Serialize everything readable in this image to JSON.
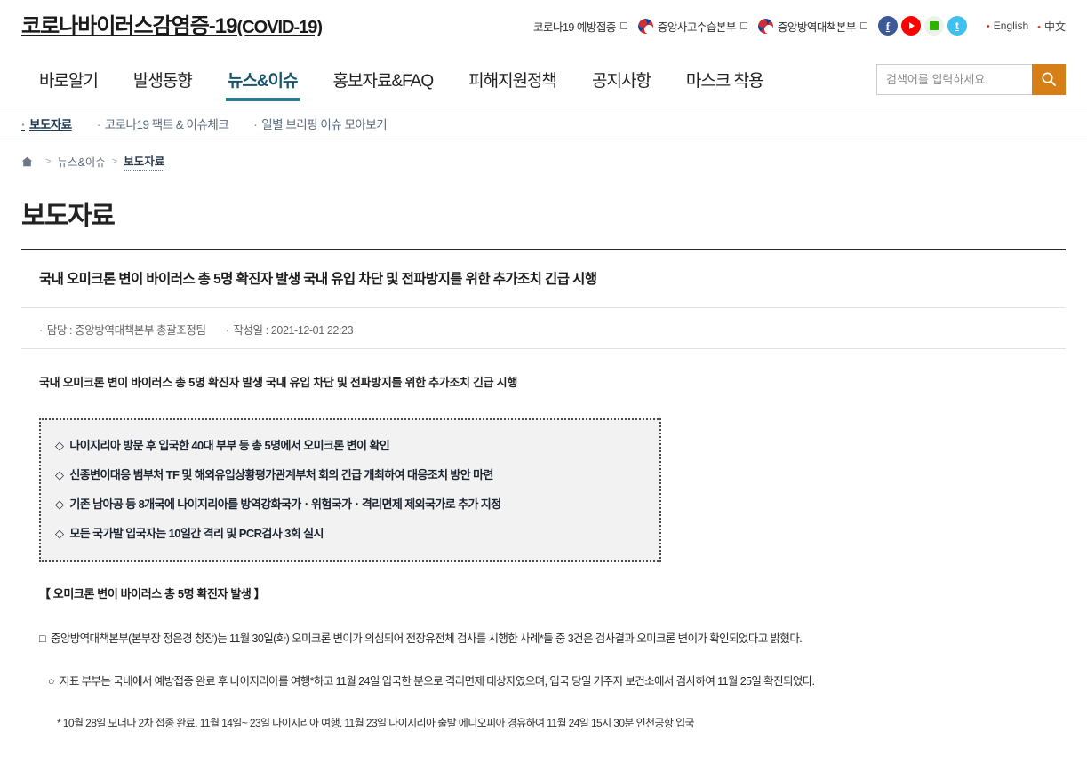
{
  "header": {
    "logo_ko": "코로나바이러스감염증-19",
    "logo_en": "(COVID-19)",
    "links": [
      {
        "label": "코로나19 예방접종",
        "icon": "external-link-icon",
        "has_gov_mark": false
      },
      {
        "label": "중앙사고수습본부",
        "icon": "external-link-icon",
        "has_gov_mark": true
      },
      {
        "label": "중앙방역대책본부",
        "icon": "external-link-icon",
        "has_gov_mark": true
      }
    ],
    "social": [
      {
        "name": "facebook-icon",
        "glyph": "f",
        "color": "#3b5998"
      },
      {
        "name": "youtube-icon",
        "glyph": "",
        "color": "#ff0000"
      },
      {
        "name": "naver-blog-icon",
        "glyph": "",
        "color": "#2db400"
      },
      {
        "name": "twitter-icon",
        "glyph": "t",
        "color": "#3ec1ee"
      }
    ],
    "lang_links": [
      "English",
      "中文"
    ]
  },
  "nav": {
    "items": [
      {
        "label": "바로알기",
        "active": false
      },
      {
        "label": "발생동향",
        "active": false
      },
      {
        "label": "뉴스&이슈",
        "active": true
      },
      {
        "label": "홍보자료&FAQ",
        "active": false
      },
      {
        "label": "피해지원정책",
        "active": false
      },
      {
        "label": "공지사항",
        "active": false
      },
      {
        "label": "마스크 착용",
        "active": false
      }
    ],
    "accent_color": "#2a7a91"
  },
  "search": {
    "placeholder": "검색어를 입력하세요.",
    "value": "",
    "button_icon": "search-icon",
    "button_color": "#d57f16"
  },
  "subnav": {
    "items": [
      {
        "label": "보도자료",
        "active": true
      },
      {
        "label": "코로나19 팩트 & 이슈체크",
        "active": false
      },
      {
        "label": "일별 브리핑 이슈 모아보기",
        "active": false
      }
    ]
  },
  "breadcrumb": {
    "home_icon": "home-icon",
    "items": [
      {
        "label": "뉴스&이슈",
        "active": false
      },
      {
        "label": "보도자료",
        "active": true
      }
    ]
  },
  "page": {
    "title": "보도자료"
  },
  "article": {
    "title": "국내 오미크론 변이 바이러스 총 5명 확진자 발생 국내 유입 차단 및 전파방지를 위한 추가조치 긴급 시행",
    "meta": {
      "department_label": "담당 : 중앙방역대책본부 총괄조정팀",
      "date_label": "작성일 : 2021-12-01 22:23"
    },
    "body_title": "국내 오미크론 변이 바이러스 총 5명 확진자 발생 국내 유입 차단 및 전파방지를 위한 추가조치 긴급 시행",
    "highlights": [
      "나이지리아 방문 후 입국한 40대 부부 등 총 5명에서 오미크론 변이 확인",
      "신종변이대응 범부처 TF 및 해외유입상황평가관계부처 회의 긴급 개최하여 대응조치 방안 마련",
      "기존 남아공 등 8개국에 나이지리아를 방역강화국가ㆍ위험국가ㆍ격리면제 제외국가로 추가 지정",
      "모든 국가발 입국자는 10일간 격리 및 PCR검사 3회 실시"
    ],
    "highlight_bullet": "◇",
    "section_head": "【 오미크론 변이 바이러스 총 5명 확진자 발생 】",
    "paragraphs": [
      {
        "marker": "□",
        "text": "중앙방역대책본부(본부장 정은경 청장)는 11월 30일(화) 오미크론 변이가 의심되어 전장유전체 검사를 시행한 사례*들 중 3건은 검사결과 오미크론 변이가 확인되었다고 밝혔다."
      },
      {
        "marker": "○",
        "text": "지표 부부는 국내에서 예방접종 완료 후 나이지리아를 여행*하고 11월 24일 입국한 분으로 격리면제 대상자였으며, 입국 당일 거주지 보건소에서 검사하여 11월 25일 확진되었다."
      }
    ],
    "footnote": "* 10월 28일 모더나 2차 접종 완료. 11월 14일~ 23일 나이지리아 여행. 11월 23일 나이지리아 출발 에디오피아 경유하여 11월 24일 15시 30분 인천공항 입국"
  }
}
